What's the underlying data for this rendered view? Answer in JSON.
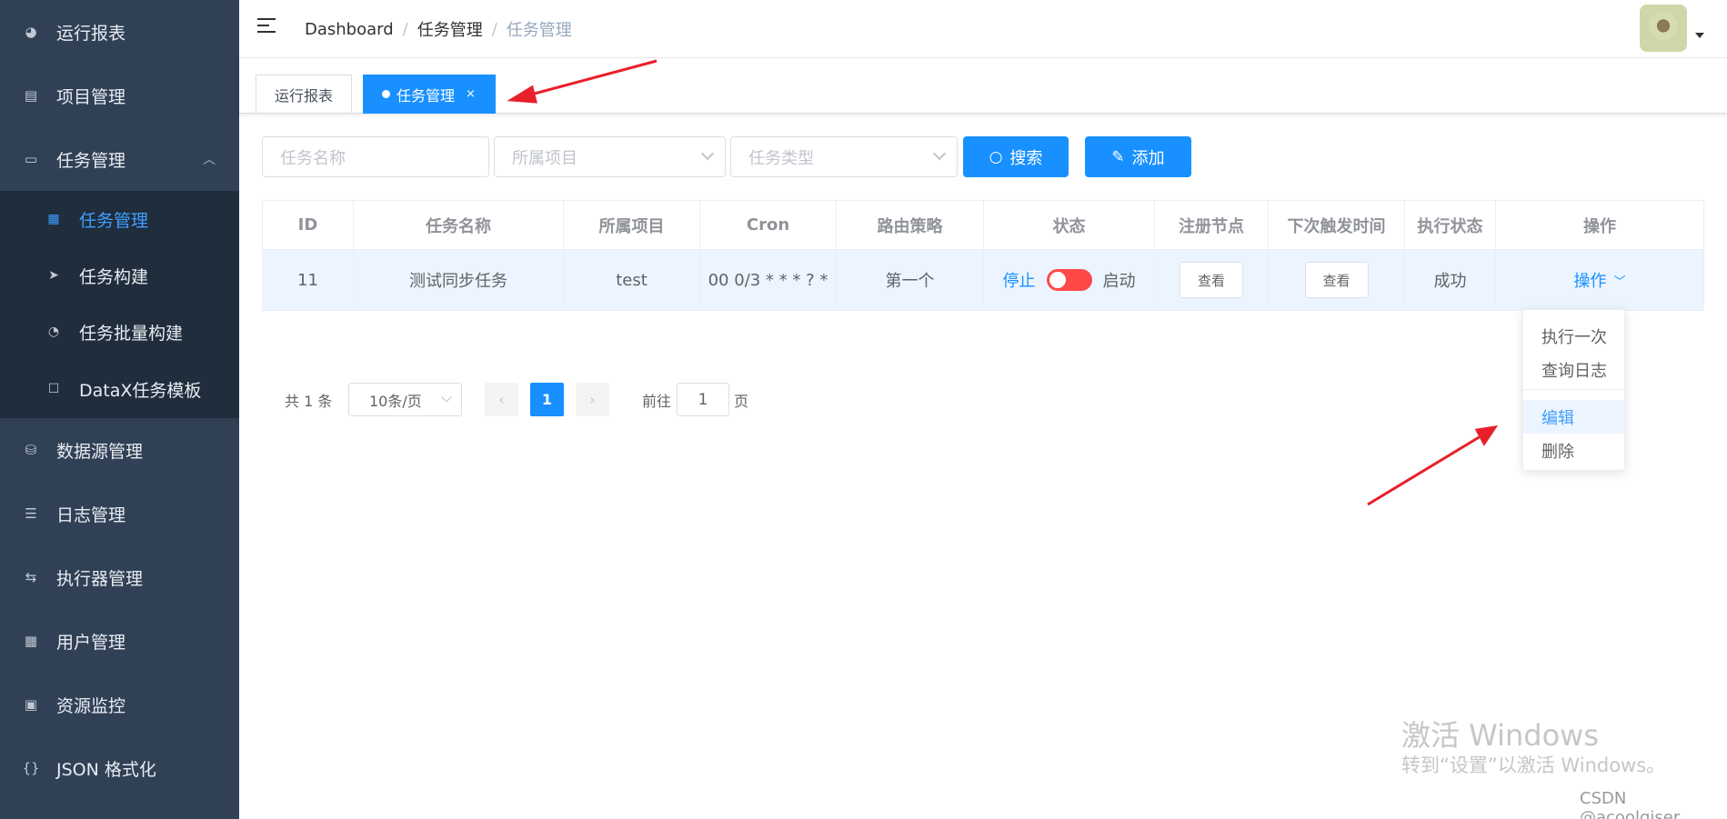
{
  "sidebar": {
    "items": [
      {
        "label": "运行报表",
        "icon": "dashboard-icon"
      },
      {
        "label": "项目管理",
        "icon": "project-icon"
      },
      {
        "label": "任务管理",
        "icon": "monitor-icon"
      },
      {
        "label": "数据源管理",
        "icon": "database-icon"
      },
      {
        "label": "日志管理",
        "icon": "log-icon"
      },
      {
        "label": "执行器管理",
        "icon": "executor-icon"
      },
      {
        "label": "用户管理",
        "icon": "user-table-icon"
      },
      {
        "label": "资源监控",
        "icon": "battery-icon"
      },
      {
        "label": "JSON 格式化",
        "icon": "braces-icon"
      }
    ],
    "submenu": [
      {
        "label": "任务管理",
        "icon": "calendar-icon",
        "active": true
      },
      {
        "label": "任务构建",
        "icon": "send-icon"
      },
      {
        "label": "任务批量构建",
        "icon": "dashboard-gauge-icon"
      },
      {
        "label": "DataX任务模板",
        "icon": "clipboard-icon"
      }
    ]
  },
  "navbar": {
    "breadcrumb": [
      "Dashboard",
      "任务管理",
      "任务管理"
    ],
    "separator": "/"
  },
  "tags": [
    {
      "label": "运行报表"
    },
    {
      "label": "任务管理",
      "close": "×"
    }
  ],
  "filters": {
    "task_name_placeholder": "任务名称",
    "project_placeholder": "所属项目",
    "task_type_placeholder": "任务类型",
    "search_label": "搜索",
    "add_label": "添加"
  },
  "table": {
    "headers": [
      "ID",
      "任务名称",
      "所属项目",
      "Cron",
      "路由策略",
      "状态",
      "注册节点",
      "下次触发时间",
      "执行状态",
      "操作"
    ],
    "rows": [
      {
        "id": "11",
        "name": "测试同步任务",
        "project": "test",
        "cron": "00 0/3 * * * ? *",
        "route": "第一个",
        "status_stop": "停止",
        "status_start": "启动",
        "nodes_btn": "查看",
        "next_btn": "查看",
        "exec_status": "成功",
        "action": "操作"
      }
    ]
  },
  "dropdown": {
    "items": [
      "执行一次",
      "查询日志",
      "编辑",
      "删除"
    ]
  },
  "pagination": {
    "total_text": "共 1 条",
    "page_size": "10条/页",
    "current_page": "1",
    "goto_label": "前往",
    "goto_value": "1",
    "page_suffix": "页"
  },
  "watermark": {
    "line1": "激活 Windows",
    "line2": "转到“设置”以激活 Windows。",
    "credit": "CSDN @acoolgiser"
  },
  "colors": {
    "sidebar_bg": "#304156",
    "submenu_bg": "#1f2d3d",
    "primary": "#1890ff",
    "switch_off": "#ff4949",
    "arrow": "#e8202a"
  }
}
